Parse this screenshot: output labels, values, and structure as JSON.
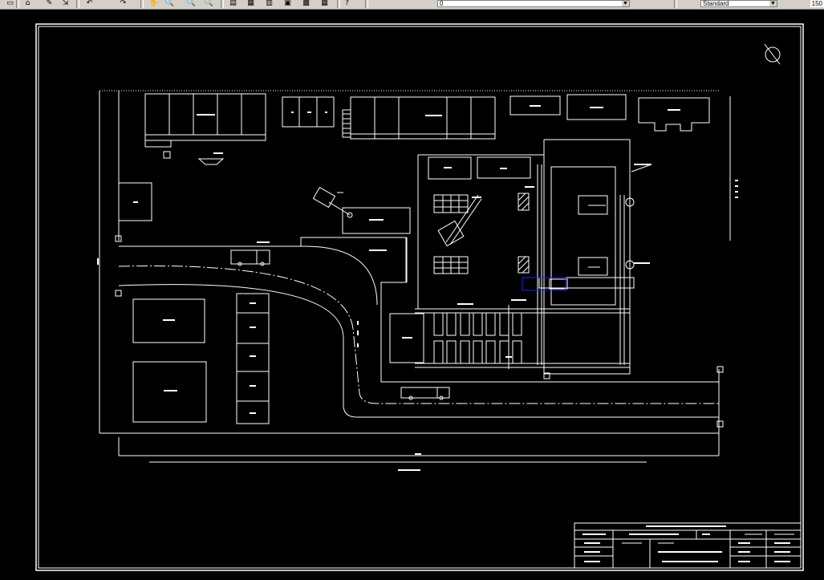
{
  "toolbar": {
    "buttons": [
      {
        "name": "new-icon",
        "glyph": "▭"
      },
      {
        "name": "open-icon",
        "glyph": "⌂"
      },
      {
        "name": "pencil-icon",
        "glyph": "✎"
      },
      {
        "name": "match-properties-icon",
        "glyph": "⇲"
      },
      {
        "name": "undo-icon",
        "glyph": "↶"
      },
      {
        "name": "redo-icon",
        "glyph": "↷"
      },
      {
        "name": "pan-icon",
        "glyph": "✋"
      },
      {
        "name": "zoom-realtime-icon",
        "glyph": "🔍"
      },
      {
        "name": "zoom-window-icon",
        "glyph": "🔍"
      },
      {
        "name": "zoom-previous-icon",
        "glyph": "🔍"
      },
      {
        "name": "properties-icon",
        "glyph": "▤"
      },
      {
        "name": "design-center-icon",
        "glyph": "▦"
      },
      {
        "name": "tool-palettes-icon",
        "glyph": "▥"
      },
      {
        "name": "sheet-set-icon",
        "glyph": "▣"
      },
      {
        "name": "markup-icon",
        "glyph": "▩"
      },
      {
        "name": "calculator-icon",
        "glyph": "▦"
      },
      {
        "name": "help-icon",
        "glyph": "?"
      }
    ],
    "layer_value": "0",
    "style_value": "Standard",
    "scale_value": "150"
  },
  "colors": {
    "background": "#000000",
    "lines": "#ffffff",
    "selection": "#2020ff"
  }
}
